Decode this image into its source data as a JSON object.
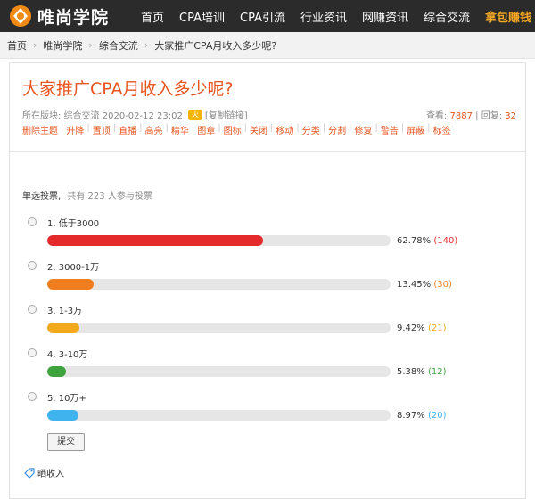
{
  "site": {
    "name": "唯尚学院"
  },
  "nav": [
    "首页",
    "CPA培训",
    "CPA引流",
    "行业资讯",
    "网赚资讯",
    "综合交流",
    "拿包赚钱"
  ],
  "breadcrumb": [
    "首页",
    "唯尚学院",
    "综合交流",
    "大家推广CPA月收入多少呢?"
  ],
  "thread": {
    "title": "大家推广CPA月收入多少呢?",
    "meta": "所在版块: 综合交流 2020-02-12 23:02",
    "hot_badge": "火",
    "copy_link": "[复制链接]",
    "views_label": "查看:",
    "views": "7887",
    "replies_label": "回复:",
    "replies": "32"
  },
  "admin_actions": [
    "删除主题",
    "升降",
    "置顶",
    "直播",
    "高亮",
    "精华",
    "图章",
    "图标",
    "关闭",
    "移动",
    "分类",
    "分割",
    "修复",
    "警告",
    "屏蔽",
    "标签"
  ],
  "poll": {
    "title": "单选投票",
    "subtitle": "共有 223 人参与投票",
    "options": [
      {
        "label": "1.  低于3000",
        "percent": "62.78%",
        "count": "(140)",
        "fraction": 0.6278,
        "color": "#e42a2a"
      },
      {
        "label": "2.  3000-1万",
        "percent": "13.45%",
        "count": "(30)",
        "fraction": 0.1345,
        "color": "#f07e1f"
      },
      {
        "label": "3.  1-3万",
        "percent": "9.42%",
        "count": "(21)",
        "fraction": 0.0942,
        "color": "#f3a91c"
      },
      {
        "label": "4.  3-10万",
        "percent": "5.38%",
        "count": "(12)",
        "fraction": 0.0538,
        "color": "#3ea33c"
      },
      {
        "label": "5.  10万+",
        "percent": "8.97%",
        "count": "(20)",
        "fraction": 0.0897,
        "color": "#3fb3ee"
      }
    ],
    "submit_label": "提交"
  },
  "footer": {
    "income_label": "晒收入"
  }
}
